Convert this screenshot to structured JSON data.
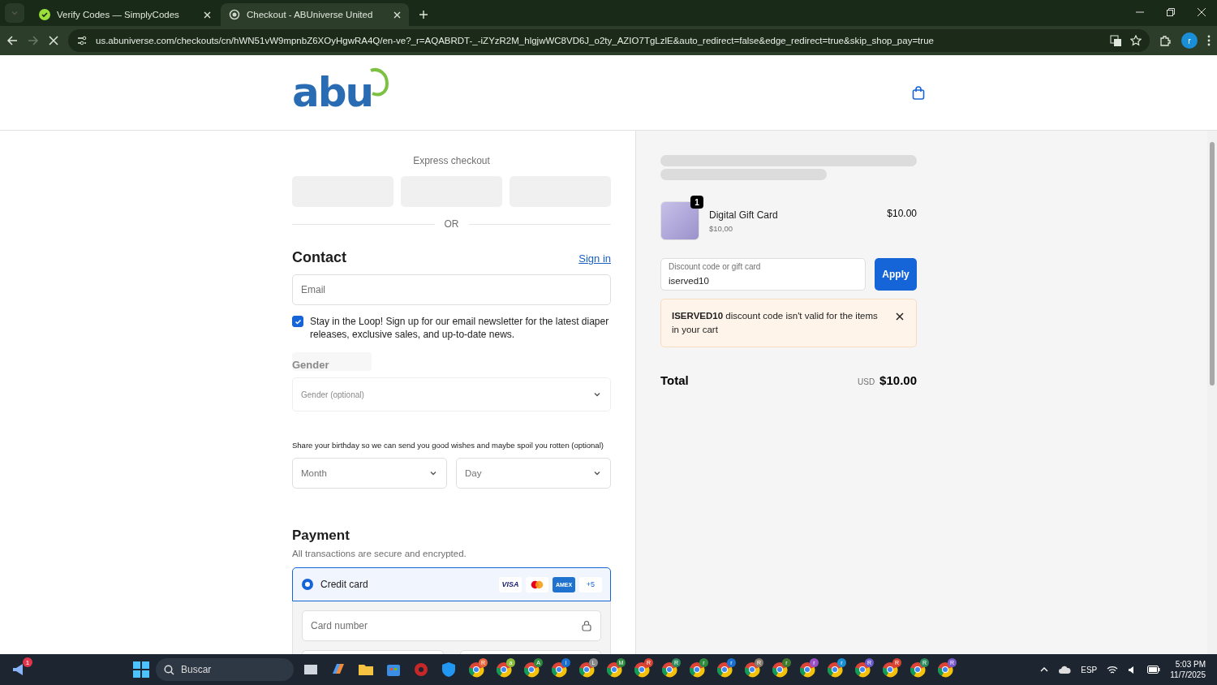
{
  "browser": {
    "tabs": [
      {
        "title": "Verify Codes — SimplyCodes",
        "selected": false
      },
      {
        "title": "Checkout - ABUniverse United",
        "selected": true
      }
    ],
    "url": "us.abuniverse.com/checkouts/cn/hWN51vW9mpnbZ6XOyHgwRA4Q/en-ve?_r=AQABRDT-_-iZYzR2M_hlgjwWC8VD6J_o2ty_AZIO7TgLzlE&auto_redirect=false&edge_redirect=true&skip_shop_pay=true",
    "profile_initial": "r"
  },
  "header": {
    "logo": "abu"
  },
  "express_checkout": {
    "title": "Express checkout",
    "separator": "OR"
  },
  "contact": {
    "title": "Contact",
    "sign_in": "Sign in",
    "email": {
      "placeholder": "Email"
    },
    "newsletter": {
      "label": "Stay in the Loop! Sign up for our email newsletter for the latest diaper releases, exclusive sales, and up-to-date news.",
      "checked": true
    },
    "gender_label": "Gender",
    "gender": {
      "placeholder": "Gender (optional)"
    },
    "birthday_hint": "Share your birthday so we can send you good wishes and maybe spoil you rotten (optional)",
    "birthday": [
      {
        "placeholder": "Month"
      },
      {
        "placeholder": "Day"
      }
    ]
  },
  "payment": {
    "title": "Payment",
    "subtitle": "All transactions are secure and encrypted.",
    "methods": [
      {
        "label": "Credit card",
        "selected": true,
        "brands": [
          "VISA",
          "AMEX"
        ],
        "more": "+5"
      }
    ],
    "card_number": {
      "placeholder": "Card number"
    }
  },
  "summary": {
    "items": [
      {
        "name": "Digital Gift Card",
        "unit_price": "$10,00",
        "quantity": "1",
        "price": "$10.00"
      }
    ],
    "discount": {
      "label": "Discount code or gift card",
      "value": "iserved10",
      "button": "Apply"
    },
    "error": {
      "text": "**ISERVED10** discount code isn't valid for the items in your cart"
    },
    "total_label": "Total",
    "currency": "USD",
    "total": "$10.00"
  },
  "taskbar": {
    "notification_count": "1",
    "search": "Buscar",
    "chrome_badges": [
      {
        "letter": "R",
        "color": "#e8663d"
      },
      {
        "letter": "a",
        "color": "#8bbd3a"
      },
      {
        "letter": "A",
        "color": "#2e8b3e"
      },
      {
        "letter": "i",
        "color": "#1a6fd1"
      },
      {
        "letter": "L",
        "color": "#8a8a8a"
      },
      {
        "letter": "M",
        "color": "#2e8b3e"
      },
      {
        "letter": "R",
        "color": "#d8432f"
      },
      {
        "letter": "R",
        "color": "#2e8b5e"
      },
      {
        "letter": "r",
        "color": "#2e8b3e"
      },
      {
        "letter": "r",
        "color": "#1a6fd1"
      },
      {
        "letter": "R",
        "color": "#8a7a6a"
      },
      {
        "letter": "r",
        "color": "#3f7a2e"
      },
      {
        "letter": "r",
        "color": "#9b4fc4"
      },
      {
        "letter": "r",
        "color": "#1a8fd1"
      },
      {
        "letter": "R",
        "color": "#6a5acd"
      },
      {
        "letter": "R",
        "color": "#d8432f"
      },
      {
        "letter": "R",
        "color": "#2e8b5e"
      },
      {
        "letter": "R",
        "color": "#7a5acd"
      }
    ],
    "language": "ESP",
    "time": "5:03 PM",
    "date": "11/7/2025"
  }
}
